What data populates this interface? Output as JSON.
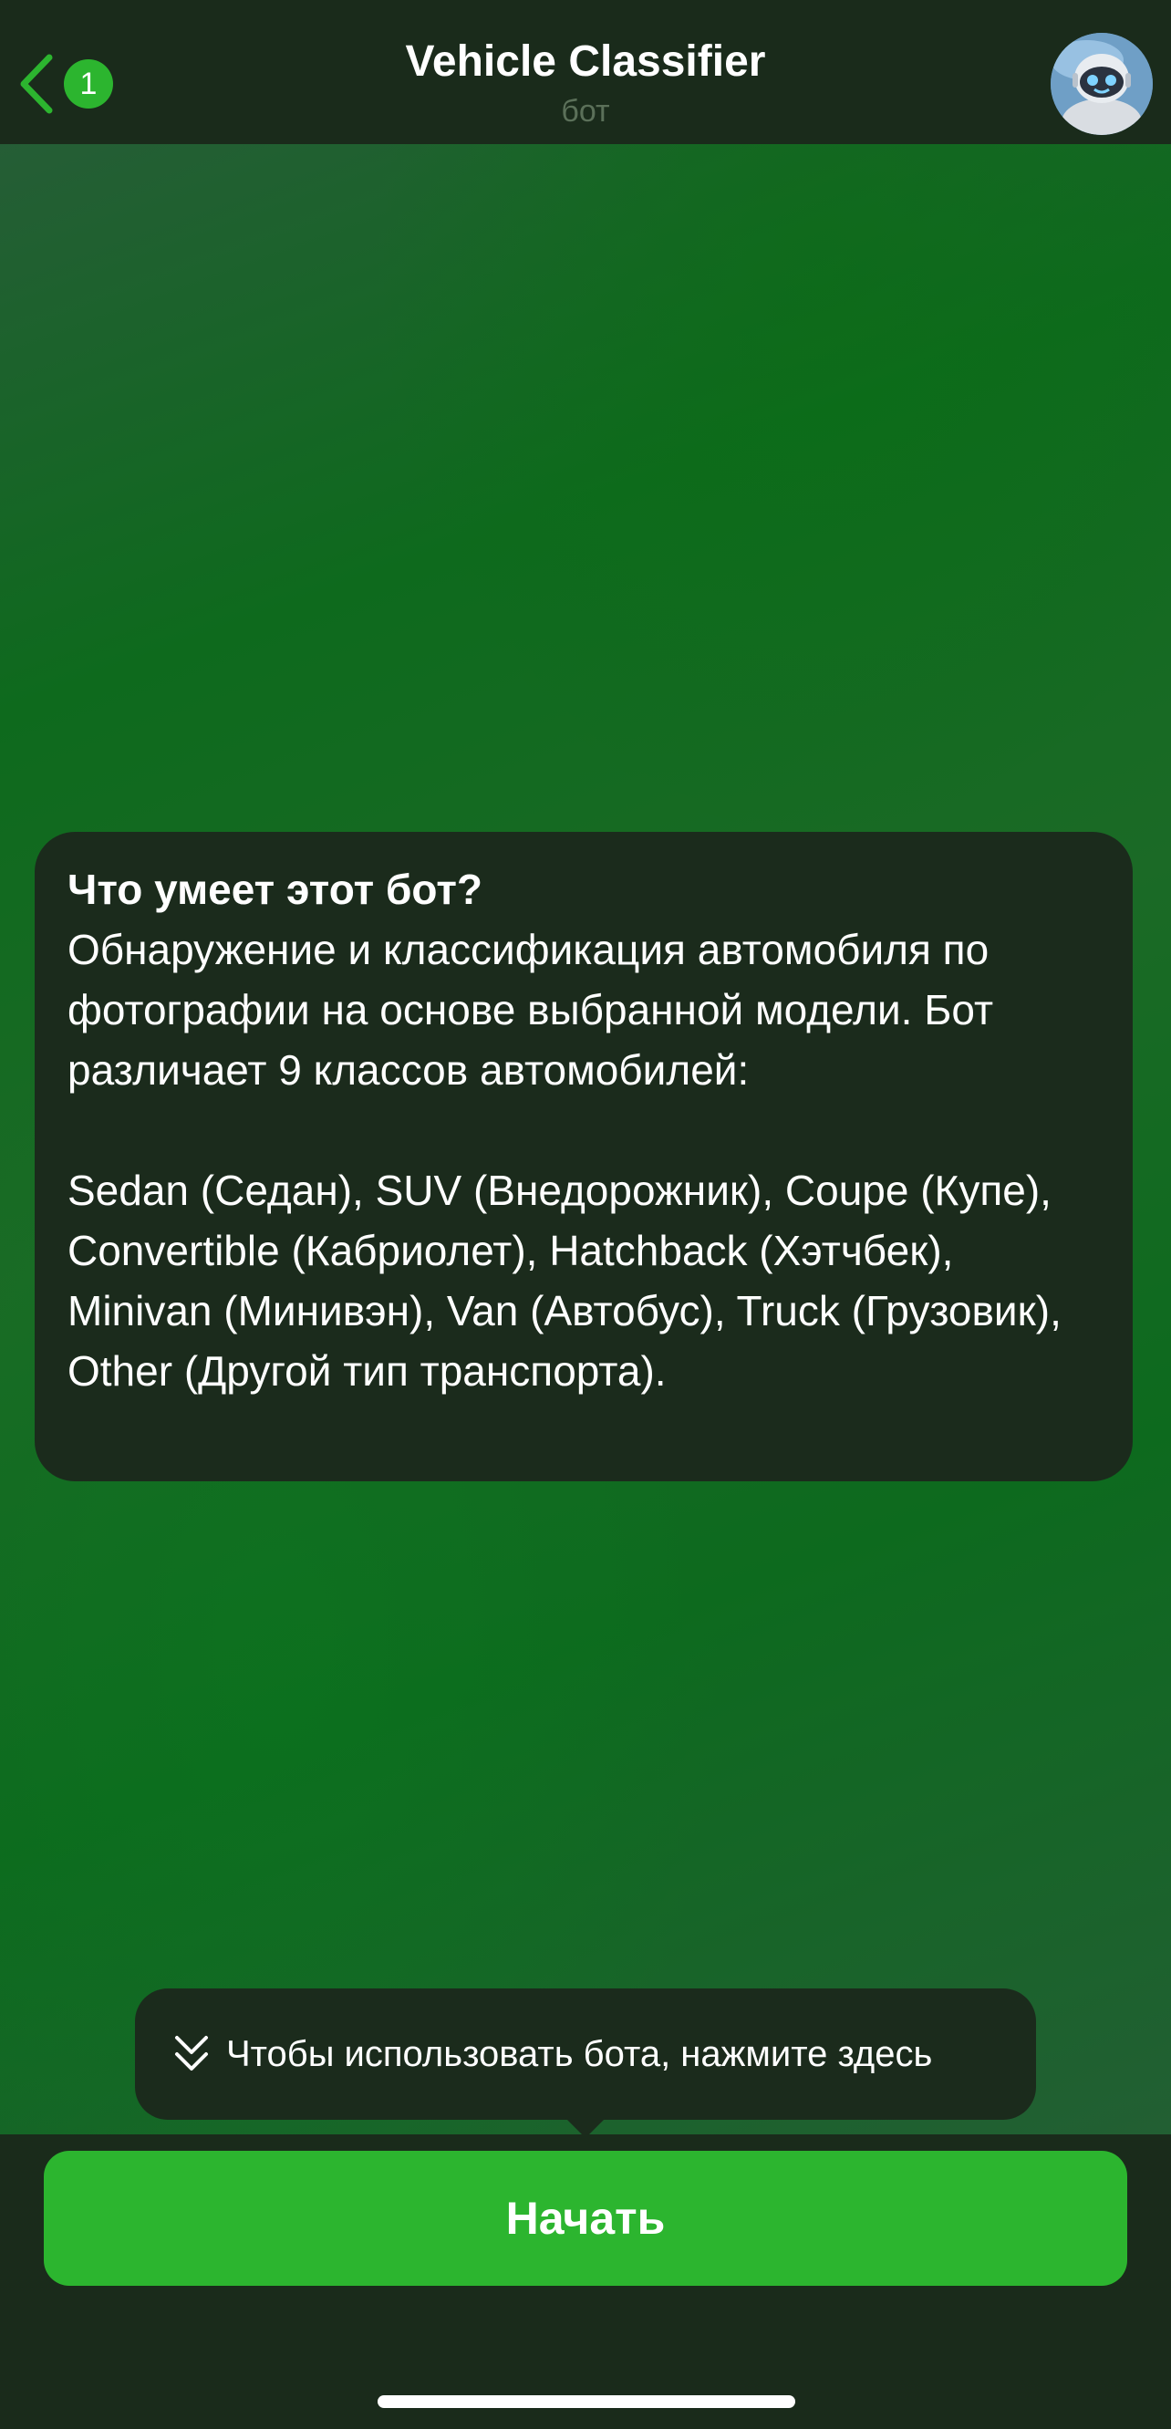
{
  "header": {
    "unread_count": "1",
    "title": "Vehicle Classifier",
    "subtitle": "бот"
  },
  "info": {
    "title": "Что умеет этот бот?",
    "text": "Обнаружение и классификация автомобиля по фотографии на основе выбранной модели. Бот различает 9 классов автомобилей:\n\nSedan (Седан), SUV (Внедорожник), Coupe (Купе), Convertible (Кабриолет), Hatchback (Хэтчбек), Minivan (Минивэн), Van (Автобус), Truck (Грузовик), Other (Другой тип транспорта)."
  },
  "hint": {
    "text": "Чтобы использовать бота, нажмите здесь"
  },
  "start_button": {
    "label": "Начать"
  },
  "colors": {
    "accent": "#2cb52f",
    "bar_background": "#1a2b1b",
    "bubble_background": "#1b2b1c"
  },
  "icons": {
    "back": "chevron-left-icon",
    "hint": "double-chevron-down-icon",
    "avatar": "robot-avatar"
  }
}
